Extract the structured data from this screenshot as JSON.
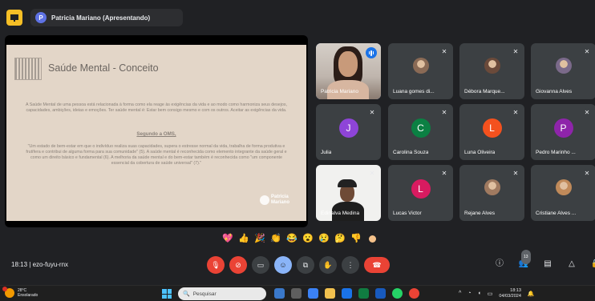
{
  "topbar": {
    "presenter_initial": "P",
    "presenter_label": "Patricia Mariano (Apresentando)"
  },
  "slide": {
    "title": "Saúde Mental - Conceito",
    "paragraph": "A Saúde Mental de uma pessoa está relacionada à forma como ela reage às exigências da vida e ao modo como harmoniza seus desejos, capacidades, ambições, ideias e emoções. Ter saúde mental é: Estar bem consigo mesmo e com os outros. Aceitar as exigências da vida.",
    "subtitle": "Segundo a OMS,",
    "quote": "\"Um estado de bem-estar em que o indivíduo realiza suas capacidades, supera o estresse normal da vida, trabalha de forma produtiva e frutífera e contribui de alguma forma para sua comunidade\" (5). A saúde mental é reconhecida como elemento integrante da saúde geral e como um direito básico e fundamental (6). A melhoria da saúde mental e do bem-estar também é reconhecida como \"um componente essencial da cobertura de saúde universal\" (7).\"",
    "brand_line1": "Patricia",
    "brand_line2": "Mariano"
  },
  "participants": [
    {
      "name": "Patricia Mariano",
      "type": "video",
      "speaking": true
    },
    {
      "name": "Luana gomes di...",
      "type": "photo",
      "color": "#8a6a55"
    },
    {
      "name": "Débora Marque...",
      "type": "photo",
      "color": "#6b4a3a"
    },
    {
      "name": "Giovanna Alves",
      "type": "photo",
      "color": "#7b6a8a"
    },
    {
      "name": "Julia",
      "type": "letter",
      "letter": "J",
      "color": "#8e44d8"
    },
    {
      "name": "Carolina Souza",
      "type": "letter",
      "letter": "C",
      "color": "#0b8043"
    },
    {
      "name": "Luna Oliveira",
      "type": "letter",
      "letter": "L",
      "color": "#f4511e"
    },
    {
      "name": "Pedro Marinho ...",
      "type": "letter",
      "letter": "P",
      "color": "#8e24aa"
    },
    {
      "name": "Edinalva Medina",
      "type": "video2"
    },
    {
      "name": "Lucas Victor",
      "type": "letter",
      "letter": "L",
      "color": "#d81b60"
    },
    {
      "name": "Rejane Alves",
      "type": "photo",
      "color": "#a07a60"
    },
    {
      "name": "Cristiane Alves ...",
      "type": "photo",
      "color": "#c08a5a"
    }
  ],
  "reactions": [
    "💖",
    "👍",
    "🎉",
    "👏",
    "😂",
    "😮",
    "😢",
    "🤔",
    "👎"
  ],
  "meeting": {
    "time": "18:13",
    "separator": "|",
    "code": "ezo-fuyu-rnx"
  },
  "controls": {
    "participant_count": "13"
  },
  "taskbar": {
    "temperature": "28°C",
    "weather_desc": "Ensolarado",
    "search_placeholder": "Pesquisar",
    "clock_time": "18:13",
    "clock_date": "04/03/2024"
  }
}
